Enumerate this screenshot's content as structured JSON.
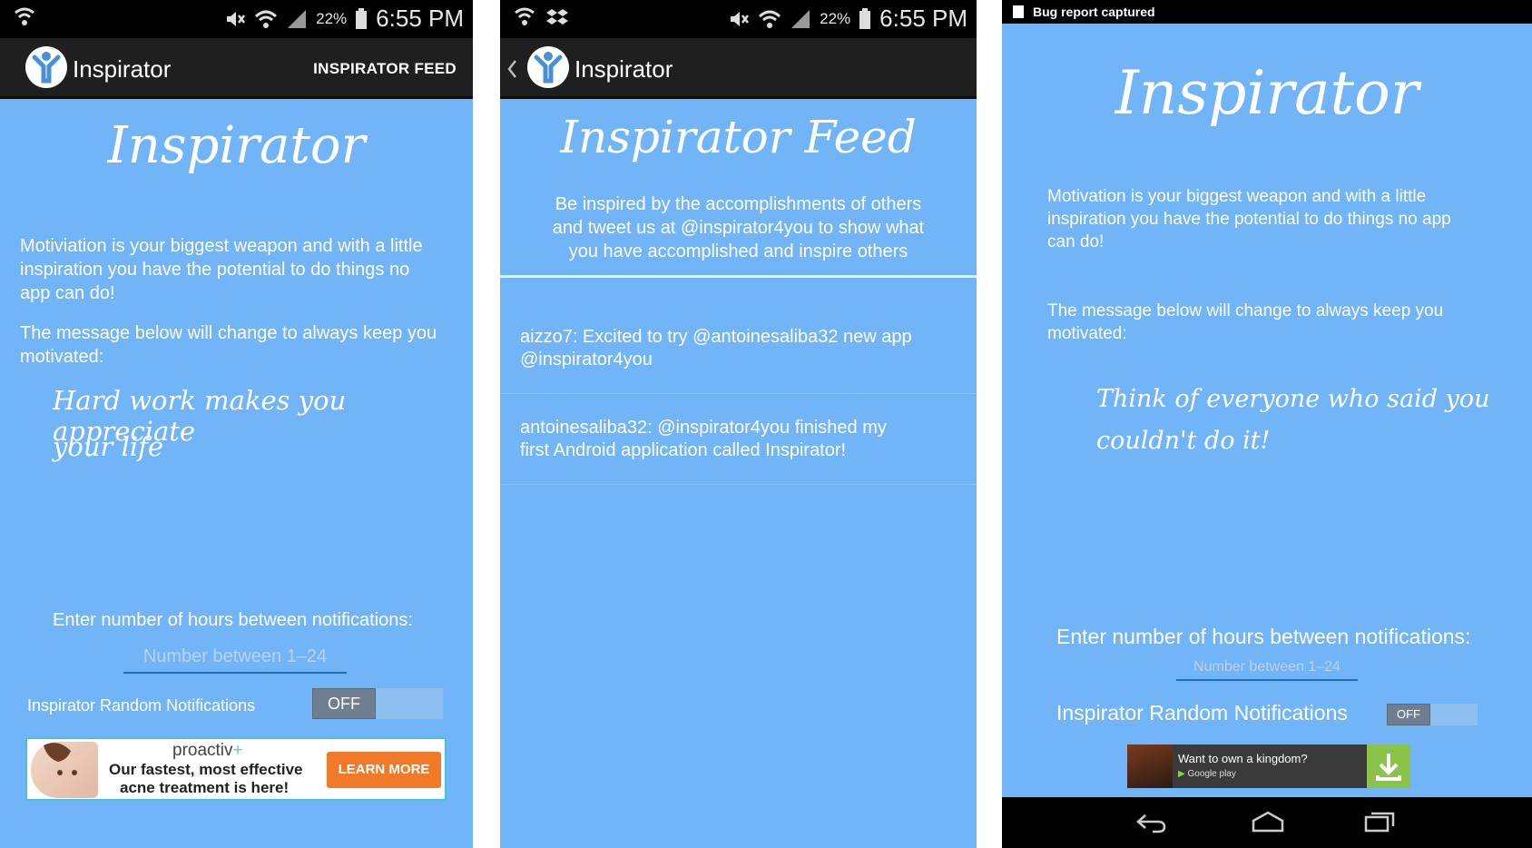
{
  "screens": [
    {
      "status": {
        "battery": "22%",
        "time": "6:55 PM"
      },
      "app_title": "Inspirator",
      "action_label": "INSPIRATOR FEED",
      "heading": "Inspirator",
      "intro": "Motiviation is your biggest weapon and with a little inspiration you have the potential to do things no app can do!",
      "message_intro": "The message below will change to always keep you motivated:",
      "quote_line1": "Hard work makes you appreciate",
      "quote_line2": "your life",
      "hours_label": "Enter number of hours between notifications:",
      "hours_placeholder": "Number between 1–24",
      "notifications_label": "Inspirator Random Notifications",
      "toggle_state": "OFF",
      "ad": {
        "brand": "proactiv",
        "brand_plus": "+",
        "text_line1": "Our fastest, most effective",
        "text_line2": "acne treatment is here!",
        "cta": "LEARN MORE"
      }
    },
    {
      "status": {
        "battery": "22%",
        "time": "6:55 PM"
      },
      "app_title": "Inspirator",
      "heading": "Inspirator Feed",
      "intro_line1": "Be inspired by the accomplishments of others",
      "intro_line2": "and tweet us at @inspirator4you to show what",
      "intro_line3": "you have accomplished and inspire others",
      "feed": [
        {
          "line1": "aizzo7: Excited to try @antoinesaliba32 new app",
          "line2": "@inspirator4you"
        },
        {
          "line1": "antoinesaliba32: @inspirator4you finished my",
          "line2": "first Android application called Inspirator!"
        }
      ]
    },
    {
      "bug_report": "Bug report captured",
      "heading": "Inspirator",
      "intro": "Motivation is your biggest weapon and with a little inspiration you have the potential to do things no app can do!",
      "message_intro": "The message below will change to always keep you motivated:",
      "quote_line1": "Think of everyone who said you",
      "quote_line2": "couldn't do it!",
      "hours_label": "Enter number of hours between notifications:",
      "hours_placeholder": "Number between 1–24",
      "notifications_label": "Inspirator Random Notifications",
      "toggle_state": "OFF",
      "ad": {
        "text": "Want to own a kingdom?",
        "store": "Google play"
      }
    }
  ],
  "colors": {
    "background": "#72b4f8",
    "actionbar": "#1f1f1f",
    "statusbar": "#000000",
    "ad_cta": "#f07a28",
    "download": "#8bc34a"
  }
}
